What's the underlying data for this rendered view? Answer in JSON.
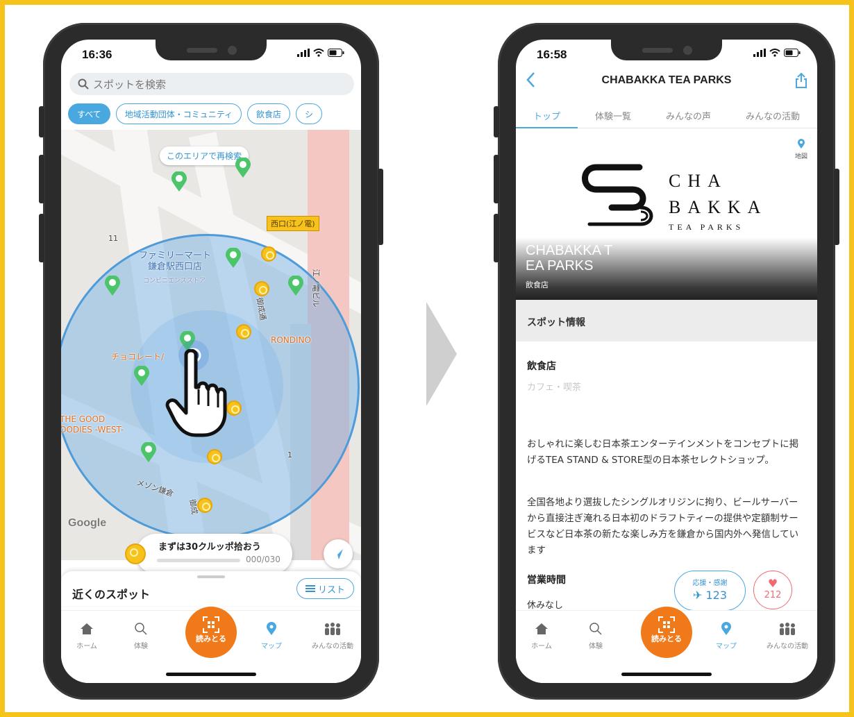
{
  "left_phone": {
    "status_time": "16:36",
    "search": {
      "placeholder": "スポットを検索"
    },
    "chips": [
      "すべて",
      "地域活動団体・コミュニティ",
      "飲食店",
      "シ"
    ],
    "research_button": "このエリアで再検索",
    "map_labels": {
      "station_tag": "西口(江ノ電)",
      "familymart": "ファミリーマート",
      "familymart_branch": "鎌倉駅西口店",
      "convenience": "コンビニエンスストア",
      "chocolate": "チョコレート/",
      "rondino": "RONDINO",
      "good_goodies_1": "THE GOOD",
      "good_goodies_2": "OODIES -WEST-",
      "maison": "メゾン鎌倉",
      "street1": "御成通",
      "street2": "御成",
      "enoden": "江ノ電ビル",
      "num11": "11",
      "num1": "1",
      "google": "Google"
    },
    "mission": {
      "title": "まずは30クルッポ拾おう",
      "progress_text": "000/030",
      "progress": 0
    },
    "sheet": {
      "title": "近くのスポット",
      "list_button": "リスト"
    },
    "tabbar": [
      {
        "label": "ホーム",
        "icon": "home-icon"
      },
      {
        "label": "体験",
        "icon": "search-icon"
      },
      {
        "label": "読みとる",
        "icon": "qr-scan-icon"
      },
      {
        "label": "マップ",
        "icon": "map-pin-icon"
      },
      {
        "label": "みんなの活動",
        "icon": "people-icon"
      }
    ]
  },
  "right_phone": {
    "status_time": "16:58",
    "title": "CHABAKKA TEA PARKS",
    "tabs": [
      "トップ",
      "体験一覧",
      "みんなの声",
      "みんなの活動"
    ],
    "map_link": "地図",
    "logo_text": {
      "l1": "CHA",
      "l2": "BAKKA",
      "l3": "TEA PARKS"
    },
    "hero_name_line1": "CHABAKKA T",
    "hero_name_line2": "EA PARKS",
    "hero_category": "飲食店",
    "section": "スポット情報",
    "category_title": "飲食店",
    "category_sub": "カフェ・喫茶",
    "desc1": "おしゃれに楽しむ日本茶エンターテインメントをコンセプトに掲げるTEA STAND & STORE型の日本茶セレクトショップ。",
    "desc2": "全国各地より選抜したシングルオリジンに拘り、ビールサーバーから直接注ぎ淹れる日本初のドラフトティーの提供や定額制サービスなど日本茶の新たな楽しみ方を鎌倉から国内外へ発信しています",
    "hours_title": "営業時間",
    "hours_value": "休みなし",
    "support": {
      "label": "応援・感謝",
      "count": "123"
    },
    "likes": "212",
    "tabbar": [
      {
        "label": "ホーム"
      },
      {
        "label": "体験"
      },
      {
        "label": "読みとる"
      },
      {
        "label": "マップ"
      },
      {
        "label": "みんなの活動"
      }
    ]
  },
  "colors": {
    "frame": "#f5c31a",
    "accent": "#4aa8e0",
    "scan": "#f07a1a",
    "heart": "#ef6b74"
  }
}
